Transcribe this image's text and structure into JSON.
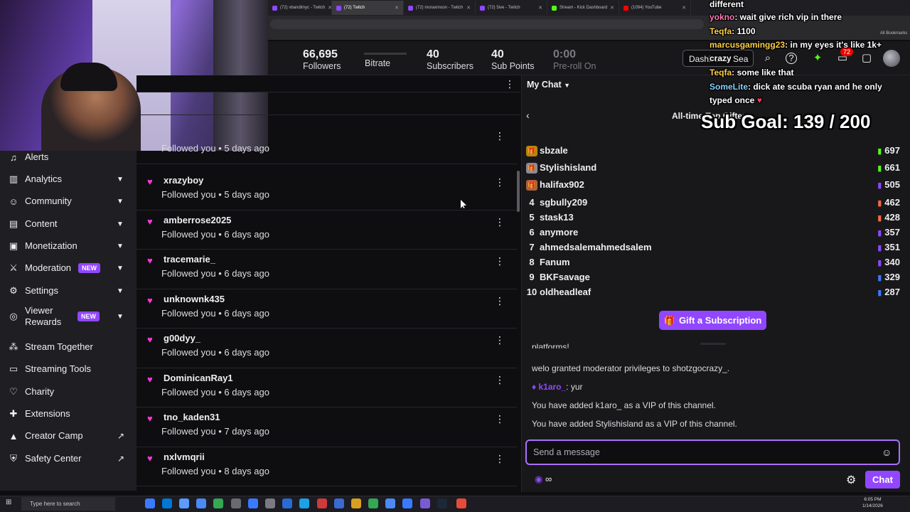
{
  "browser": {
    "tabs": [
      {
        "label": "(72) vbanditnyc - Twitch",
        "icon": "twitch-icon"
      },
      {
        "label": "(72) Twitch",
        "icon": "twitch-icon"
      },
      {
        "label": "(72) moraxmoon - Twitch",
        "icon": "twitch-icon"
      },
      {
        "label": "(72) 5ive - Twitch",
        "icon": "twitch-icon"
      },
      {
        "label": "Stream - Kick Dashboard",
        "icon": "kick-icon"
      },
      {
        "label": "(1094) YouTube",
        "icon": "youtube-icon"
      }
    ],
    "bookmarks_label": "All Bookmarks"
  },
  "stats": {
    "followers_count": "66,695",
    "followers_label": "Followers",
    "bitrate_label": "Bitrate",
    "subscribers_count": "40",
    "subscribers_label": "Subscribers",
    "sub_points_count": "40",
    "sub_points_label": "Sub Points",
    "preroll_value": "0:00",
    "preroll_label": "Pre-roll On",
    "search_text": "Dashboard Sea",
    "notification_count": "72"
  },
  "sidebar": {
    "items": [
      {
        "label": "Alerts",
        "icon": "bell-icon",
        "chevron": false
      },
      {
        "label": "Analytics",
        "icon": "chart-icon",
        "chevron": true
      },
      {
        "label": "Community",
        "icon": "community-icon",
        "chevron": true
      },
      {
        "label": "Content",
        "icon": "content-icon",
        "chevron": true
      },
      {
        "label": "Monetization",
        "icon": "monetization-icon",
        "chevron": true
      },
      {
        "label": "Moderation",
        "icon": "sword-icon",
        "chevron": true,
        "badge": "NEW"
      },
      {
        "label": "Settings",
        "icon": "gear-icon",
        "chevron": true
      },
      {
        "label": "Viewer Rewards",
        "icon": "rewards-icon",
        "chevron": true,
        "badge": "NEW"
      },
      {
        "label": "Stream Together",
        "icon": "stream-together-icon"
      },
      {
        "label": "Streaming Tools",
        "icon": "tools-icon"
      },
      {
        "label": "Charity",
        "icon": "charity-icon"
      },
      {
        "label": "Extensions",
        "icon": "extensions-icon"
      },
      {
        "label": "Creator Camp",
        "icon": "camp-icon",
        "external": true
      },
      {
        "label": "Safety Center",
        "icon": "shield-icon",
        "external": true
      }
    ]
  },
  "followers": [
    {
      "name": "",
      "when": "Followed you • 5 days ago"
    },
    {
      "name": "xrazyboy",
      "when": "Followed you • 5 days ago"
    },
    {
      "name": "amberrose2025",
      "when": "Followed you • 6 days ago"
    },
    {
      "name": "tracemarie_",
      "when": "Followed you • 6 days ago"
    },
    {
      "name": "unknownk435",
      "when": "Followed you • 6 days ago"
    },
    {
      "name": "g00dyy_",
      "when": "Followed you • 6 days ago"
    },
    {
      "name": "DominicanRay1",
      "when": "Followed you • 6 days ago"
    },
    {
      "name": "tno_kaden31",
      "when": "Followed you • 7 days ago"
    },
    {
      "name": "nxlvmqrii",
      "when": "Followed you • 8 days ago"
    }
  ],
  "chat": {
    "title": "My Chat",
    "gifters_title": "All-time Top Gifters",
    "gifters": [
      {
        "rank": "",
        "name": "sbzale",
        "count": "697",
        "medal": "#b8860b"
      },
      {
        "rank": "",
        "name": "Stylishisland",
        "count": "661",
        "medal": "#8a8a99"
      },
      {
        "rank": "",
        "name": "halifax902",
        "count": "505",
        "medal": "#b0603a"
      },
      {
        "rank": "4",
        "name": "sgbully209",
        "count": "462"
      },
      {
        "rank": "5",
        "name": "stask13",
        "count": "428"
      },
      {
        "rank": "6",
        "name": "anymore",
        "count": "357"
      },
      {
        "rank": "7",
        "name": "ahmedsalemahmedsalem",
        "count": "351"
      },
      {
        "rank": "8",
        "name": "Fanum",
        "count": "340"
      },
      {
        "rank": "9",
        "name": "BKFsavage",
        "count": "329"
      },
      {
        "rank": "10",
        "name": "oldheadleaf",
        "count": "287"
      }
    ],
    "gift_button": "Gift a Subscription",
    "messages": {
      "cut_line": "platforms!",
      "mod_line": "welo granted moderator privileges to shotzgocrazy_.",
      "user": "k1aro_",
      "user_text": ": yur",
      "vip1": "You have added k1aro_ as a VIP of this channel.",
      "vip2": "You have added Stylishisland as a VIP of this channel."
    },
    "input_placeholder": "Send a message",
    "points": "∞",
    "send_button": "Chat"
  },
  "overlay": {
    "lines": [
      {
        "user": "",
        "text": "different"
      },
      {
        "user": "yokno",
        "text": ": wait give rich vip in there"
      },
      {
        "user": "Teqfa",
        "text": ": 1100"
      },
      {
        "user": "marcusgamingg23",
        "text": ": in my eyes it's like 1k+"
      },
      {
        "user": "",
        "text": "crazy"
      },
      {
        "user": "Teqfa",
        "text": ": some like that"
      },
      {
        "user": "SomeLite",
        "text": ": dick ate scuba ryan and he only"
      },
      {
        "user": "",
        "text": "typed once"
      }
    ],
    "sub_goal": "Sub Goal:  139 / 200"
  },
  "taskbar": {
    "search_placeholder": "Type here to search",
    "time": "6:05 PM",
    "date": "1/14/2026"
  },
  "colors": {
    "accent": "#9147ff",
    "heart": "#ff38db",
    "badge_red": "#eb0400"
  }
}
